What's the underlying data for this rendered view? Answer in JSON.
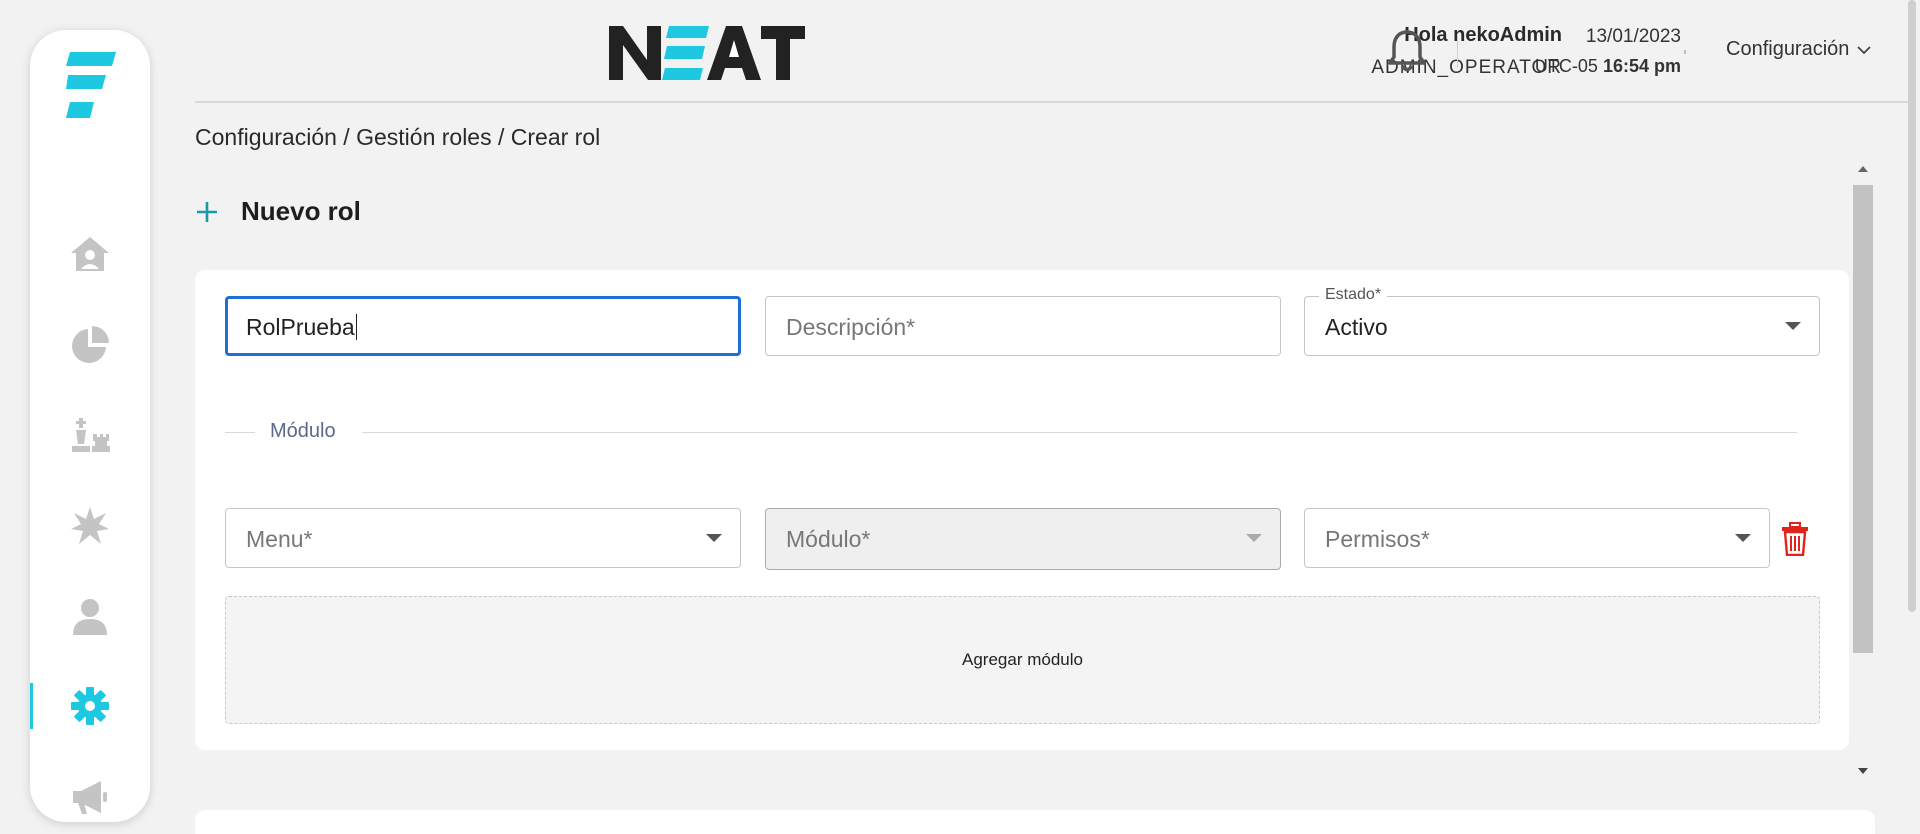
{
  "brand": {
    "name": "NEAT",
    "accent": "#1ec8e0",
    "dark": "#222222"
  },
  "sidebar": {
    "items": [
      {
        "name": "home",
        "icon": "home-user-icon"
      },
      {
        "name": "reports",
        "icon": "pie-chart-icon"
      },
      {
        "name": "strategy",
        "icon": "chess-icon"
      },
      {
        "name": "incidents",
        "icon": "burst-icon"
      },
      {
        "name": "users",
        "icon": "user-icon"
      },
      {
        "name": "settings",
        "icon": "gear-icon",
        "active": true
      },
      {
        "name": "announcements",
        "icon": "megaphone-icon"
      }
    ]
  },
  "header": {
    "greeting": "Hola nekoAdmin",
    "role": "ADMIN_OPERATOR",
    "date": "13/01/2023",
    "timezone": "UTC-05",
    "time": "16:54 pm",
    "menu_label": "Configuración"
  },
  "breadcrumb": "Configuración / Gestión roles / Crear rol",
  "page": {
    "title": "Nuevo rol"
  },
  "form": {
    "name_value": "RolPrueba",
    "description_placeholder": "Descripción*",
    "status_label": "Estado*",
    "status_value": "Activo",
    "section_label": "Módulo",
    "menu_placeholder": "Menu*",
    "module_placeholder": "Módulo*",
    "permissions_placeholder": "Permisos*",
    "add_module_label": "Agregar módulo"
  },
  "colors": {
    "focus": "#1f6fd6",
    "delete": "#e0241b",
    "muted_label": "#5a6a8a"
  }
}
